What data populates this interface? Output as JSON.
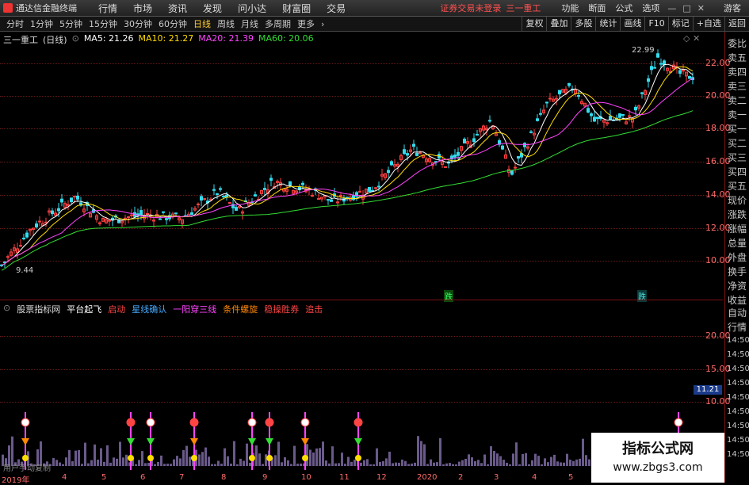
{
  "menubar": {
    "app_title": "通达信金融终端",
    "items": [
      "行情",
      "市场",
      "资讯",
      "发现",
      "问小达",
      "财富圈",
      "交易"
    ],
    "login_status": "证券交易未登录",
    "stock_name": "三一重工",
    "right_items": [
      "功能",
      "断面",
      "公式",
      "选项"
    ],
    "guest": "游客"
  },
  "periods": [
    "分时",
    "1分钟",
    "5分钟",
    "15分钟",
    "30分钟",
    "60分钟",
    "日线",
    "周线",
    "月线",
    "多周期",
    "更多"
  ],
  "active_period": "日线",
  "toolbar": [
    "复权",
    "叠加",
    "多股",
    "统计",
    "画线",
    "F10",
    "标记",
    "+自选",
    "返回"
  ],
  "main_chart": {
    "stock": "三一重工",
    "period_tag": "(日线)",
    "legend": [
      {
        "label": "MA5: 21.26",
        "color": "#ffffff"
      },
      {
        "label": "MA10: 21.27",
        "color": "#ffdd00"
      },
      {
        "label": "MA20: 21.39",
        "color": "#ff44ff"
      },
      {
        "label": "MA60: 20.06",
        "color": "#33dd33"
      }
    ],
    "y_labels": [
      "22.00",
      "20.00",
      "18.00",
      "16.00",
      "14.00",
      "12.00",
      "10.00"
    ],
    "high_label": "22.99",
    "low_label": "9.44",
    "markers": [
      {
        "text": "跌",
        "color": "#33ff66"
      },
      {
        "text": "跌",
        "color": "#55dddd"
      }
    ]
  },
  "sub_chart": {
    "name": "股票指标网",
    "legend": [
      {
        "label": "平台起飞",
        "color": "#ffffff"
      },
      {
        "label": "启动",
        "color": "#ff4444"
      },
      {
        "label": "星线确认",
        "color": "#44aaff"
      },
      {
        "label": "一阳穿三线",
        "color": "#ff44ff"
      },
      {
        "label": "条件螺旋",
        "color": "#ff8800"
      },
      {
        "label": "稳操胜券",
        "color": "#ff4444"
      },
      {
        "label": "追击",
        "color": "#ff4444"
      }
    ],
    "y_labels": [
      "20.00",
      "15.00",
      "10.00"
    ],
    "current_value": "11.21",
    "bottom_text": "用户手动复制"
  },
  "right_panel": {
    "labels": [
      "委比",
      "卖五",
      "卖四",
      "卖三",
      "卖二",
      "卖一",
      "买一",
      "买二",
      "买三",
      "买四",
      "买五",
      "现价",
      "涨跌",
      "涨幅",
      "总量",
      "外盘",
      "换手",
      "净资",
      "收益"
    ],
    "tabs": [
      "自动",
      "行情"
    ],
    "times": [
      "14:50",
      "14:50",
      "14:50",
      "14:50",
      "14:50",
      "14:50",
      "14:50",
      "14:50",
      "14:50"
    ]
  },
  "x_axis": [
    "2019年",
    "4",
    "5",
    "6",
    "7",
    "8",
    "9",
    "10",
    "11",
    "12",
    "2020",
    "2",
    "3",
    "4",
    "5",
    "6"
  ],
  "watermark": {
    "title": "指标公式网",
    "url": "www.zbgs3.com"
  }
}
